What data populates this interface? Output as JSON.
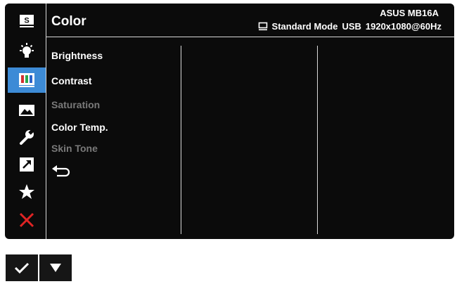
{
  "header": {
    "title": "Color",
    "model": "ASUS MB16A",
    "mode": "Standard Mode",
    "input": "USB",
    "resolution": "1920x1080@60Hz"
  },
  "sidebar": {
    "items": [
      {
        "name": "splendid",
        "icon": "s-icon",
        "letter": "S",
        "active": false
      },
      {
        "name": "blue-light-filter",
        "icon": "bulb-icon",
        "active": false
      },
      {
        "name": "color",
        "icon": "color-bars-icon",
        "active": true
      },
      {
        "name": "image",
        "icon": "image-icon",
        "active": false
      },
      {
        "name": "system-setup",
        "icon": "wrench-icon",
        "active": false
      },
      {
        "name": "shortcut",
        "icon": "shortcut-arrow-icon",
        "active": false
      },
      {
        "name": "my-favorite",
        "icon": "star-icon",
        "active": false
      },
      {
        "name": "exit",
        "icon": "close-icon",
        "active": false
      }
    ]
  },
  "menu": {
    "items": [
      {
        "label": "Brightness",
        "enabled": true
      },
      {
        "label": "Contrast",
        "enabled": true
      },
      {
        "label": "Saturation",
        "enabled": false
      },
      {
        "label": "Color Temp.",
        "enabled": true
      },
      {
        "label": "Skin Tone",
        "enabled": false
      }
    ],
    "back_icon": "return-arrow-icon"
  },
  "keys": [
    {
      "icon": "checkmark-icon"
    },
    {
      "icon": "triangle-down-icon"
    }
  ],
  "colors": {
    "accent": "#3d8bd6",
    "background": "#0b0b0b",
    "disabled_text": "#7a7a7a",
    "exit": "#e02424"
  }
}
